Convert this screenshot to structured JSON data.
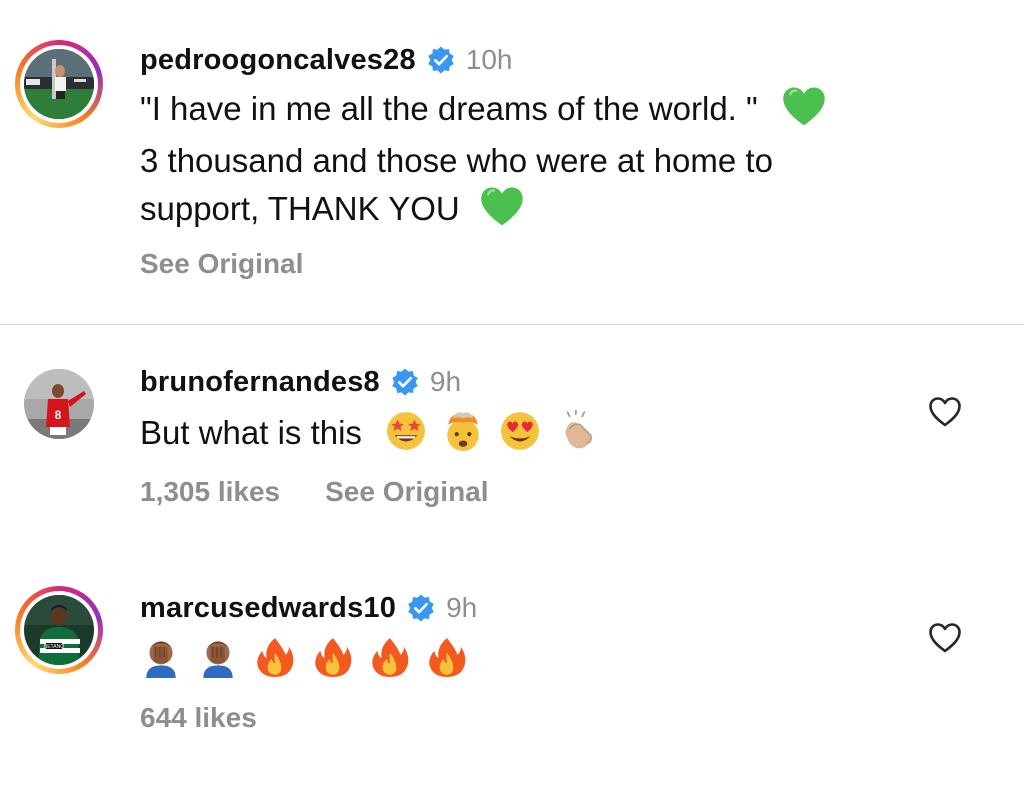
{
  "comments": [
    {
      "username": "pedroogoncalves28",
      "time": "10h",
      "line1": "\"I have in me all the dreams of the world. \"",
      "line2": "3 thousand and those who were at home to",
      "line3": "support, THANK YOU",
      "see_original": "See Original",
      "emojis": [
        "green-heart",
        "green-heart"
      ]
    },
    {
      "username": "brunofernandes8",
      "time": "9h",
      "text": "But what is this",
      "likes": "1,305 likes",
      "see_original": "See Original",
      "emojis": [
        "star-struck",
        "exploding-head",
        "heart-eyes",
        "clapping-hands"
      ]
    },
    {
      "username": "marcusedwards10",
      "time": "9h",
      "likes": "644 likes",
      "emojis": [
        "facepalm",
        "facepalm",
        "fire",
        "fire",
        "fire",
        "fire"
      ]
    }
  ],
  "colors": {
    "verified_blue": "#3897f0",
    "muted_text": "#8e8e8e",
    "divider": "#dbdbdb",
    "green_heart": "#4cc04f"
  }
}
